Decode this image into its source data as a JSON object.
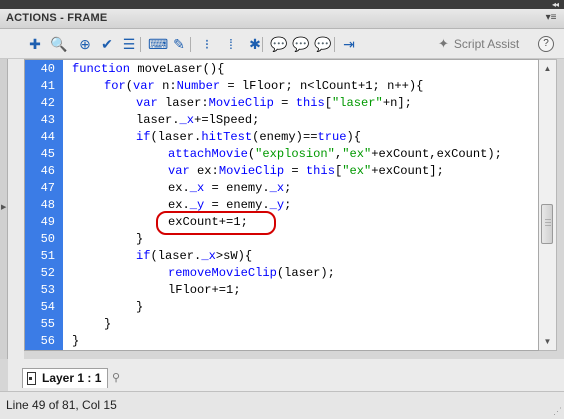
{
  "panel": {
    "title": "ACTIONS - FRAME",
    "menu_icon": "panel-menu-icon"
  },
  "toolbar": {
    "buttons": [
      {
        "name": "add-statement-icon",
        "glyph": "✚"
      },
      {
        "name": "find-icon",
        "glyph": "🔍"
      },
      {
        "name": "insert-target-path-icon",
        "glyph": "⊕"
      },
      {
        "name": "check-syntax-icon",
        "glyph": "✔"
      },
      {
        "name": "auto-format-icon",
        "glyph": "☰"
      },
      {
        "name": "show-code-hint-icon",
        "glyph": "⌨"
      },
      {
        "name": "debug-options-icon",
        "glyph": "✎"
      },
      {
        "name": "collapse-between-braces-icon",
        "glyph": "⁝"
      },
      {
        "name": "collapse-selection-icon",
        "glyph": "⁞"
      },
      {
        "name": "expand-all-icon",
        "glyph": "✱"
      },
      {
        "name": "apply-block-comment-icon",
        "glyph": "💬"
      },
      {
        "name": "apply-line-comment-icon",
        "glyph": "💬"
      },
      {
        "name": "remove-comment-icon",
        "glyph": "💬"
      },
      {
        "name": "show-hide-toolbox-icon",
        "glyph": "⇥"
      }
    ],
    "script_assist_label": "Script Assist",
    "help_label": "?"
  },
  "editor": {
    "lines": [
      {
        "num": "40",
        "indent": 0,
        "tokens": [
          [
            "kw",
            "function"
          ],
          [
            "",
            "moveLaser(){"
          ]
        ]
      },
      {
        "num": "41",
        "indent": 1,
        "tokens": [
          [
            "kw",
            "for"
          ],
          [
            "",
            "("
          ],
          [
            "kw",
            "var"
          ],
          [
            "",
            " n:"
          ],
          [
            "kw",
            "Number"
          ],
          [
            "",
            " = lFloor; n<lCount+1; n++){"
          ]
        ]
      },
      {
        "num": "42",
        "indent": 2,
        "tokens": [
          [
            "kw",
            "var"
          ],
          [
            "",
            " laser:"
          ],
          [
            "kw",
            "MovieClip"
          ],
          [
            "",
            " = "
          ],
          [
            "kw",
            "this"
          ],
          [
            "",
            "["
          ],
          [
            "str",
            "\"laser\""
          ],
          [
            "",
            "+n];"
          ]
        ]
      },
      {
        "num": "43",
        "indent": 2,
        "tokens": [
          [
            "",
            "laser."
          ],
          [
            "kw",
            "_x"
          ],
          [
            "",
            "+=lSpeed;"
          ]
        ]
      },
      {
        "num": "44",
        "indent": 2,
        "tokens": [
          [
            "kw",
            "if"
          ],
          [
            "",
            "(laser."
          ],
          [
            "kw",
            "hitTest"
          ],
          [
            "",
            "(enemy)=="
          ],
          [
            "kw",
            "true"
          ],
          [
            "",
            "){"
          ]
        ]
      },
      {
        "num": "45",
        "indent": 3,
        "tokens": [
          [
            "kw",
            "attachMovie"
          ],
          [
            "",
            "("
          ],
          [
            "str",
            "\"explosion\""
          ],
          [
            "",
            ","
          ],
          [
            "str",
            "\"ex\""
          ],
          [
            "",
            "+exCount,exCount);"
          ]
        ]
      },
      {
        "num": "46",
        "indent": 3,
        "tokens": [
          [
            "kw",
            "var"
          ],
          [
            "",
            " ex:"
          ],
          [
            "kw",
            "MovieClip"
          ],
          [
            "",
            " = "
          ],
          [
            "kw",
            "this"
          ],
          [
            "",
            "["
          ],
          [
            "str",
            "\"ex\""
          ],
          [
            "",
            "+exCount];"
          ]
        ]
      },
      {
        "num": "47",
        "indent": 3,
        "tokens": [
          [
            "",
            "ex."
          ],
          [
            "kw",
            "_x"
          ],
          [
            "",
            " = enemy."
          ],
          [
            "kw",
            "_x"
          ],
          [
            "",
            ";"
          ]
        ]
      },
      {
        "num": "48",
        "indent": 3,
        "tokens": [
          [
            "",
            "ex."
          ],
          [
            "kw",
            "_y"
          ],
          [
            "",
            " = enemy."
          ],
          [
            "kw",
            "_y"
          ],
          [
            "",
            ";"
          ]
        ]
      },
      {
        "num": "49",
        "indent": 3,
        "tokens": [
          [
            "",
            "exCount+=1;"
          ]
        ]
      },
      {
        "num": "50",
        "indent": 2,
        "tokens": [
          [
            "",
            "}"
          ]
        ]
      },
      {
        "num": "51",
        "indent": 2,
        "tokens": [
          [
            "kw",
            "if"
          ],
          [
            "",
            "(laser."
          ],
          [
            "kw",
            "_x"
          ],
          [
            "",
            ">sW){"
          ]
        ]
      },
      {
        "num": "52",
        "indent": 3,
        "tokens": [
          [
            "kw",
            "removeMovieClip"
          ],
          [
            "",
            "(laser);"
          ]
        ]
      },
      {
        "num": "53",
        "indent": 3,
        "tokens": [
          [
            "",
            "lFloor+=1;"
          ]
        ]
      },
      {
        "num": "54",
        "indent": 2,
        "tokens": [
          [
            "",
            "}"
          ]
        ]
      },
      {
        "num": "55",
        "indent": 1,
        "tokens": [
          [
            "",
            "}"
          ]
        ]
      },
      {
        "num": "56",
        "indent": 0,
        "tokens": [
          [
            "",
            "}"
          ]
        ]
      }
    ]
  },
  "tabs": [
    {
      "label": "Layer 1 : 1"
    }
  ],
  "status": {
    "text": "Line 49 of 81, Col 15"
  },
  "colors": {
    "gutter": "#3b7ce6",
    "keyword": "#0000ff",
    "string": "#009900",
    "highlight_circle": "#d40000"
  }
}
